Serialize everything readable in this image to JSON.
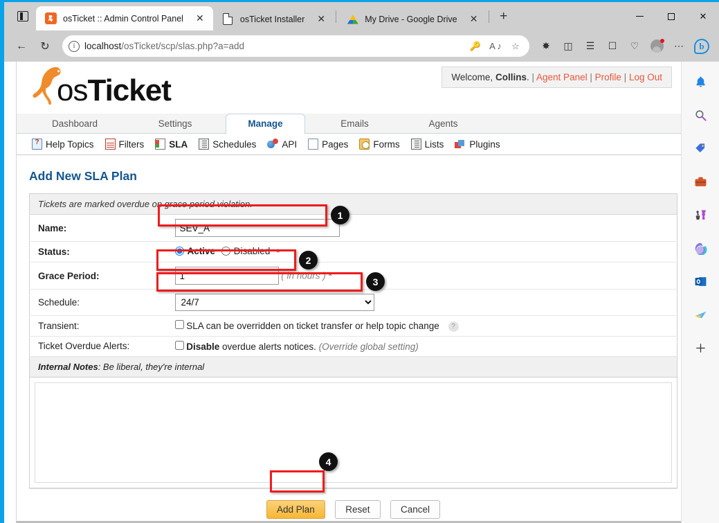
{
  "browser": {
    "tabs": [
      {
        "title": "osTicket :: Admin Control Panel",
        "icon": "osticket-favicon",
        "active": true
      },
      {
        "title": "osTicket Installer",
        "icon": "document-favicon",
        "active": false
      },
      {
        "title": "My Drive - Google Drive",
        "icon": "google-drive-favicon",
        "active": false
      }
    ],
    "new_tab_label": "+",
    "window_controls": {
      "minimize": "–",
      "maximize": "□",
      "close": "✕"
    },
    "address": {
      "host": "localhost",
      "path": "/osTicket/scp/slas.php?a=add",
      "full": "localhost/osTicket/scp/slas.php?a=add"
    },
    "back_label": "←",
    "refresh_label": "↻",
    "toolbar_icons": [
      "key-icon",
      "read-aloud-icon",
      "favorite-star-icon",
      "extensions-icon",
      "split-screen-icon",
      "collections-icon",
      "add-favorite-icon",
      "browser-essentials-icon",
      "profile-avatar",
      "settings-more-icon",
      "copilot-icon"
    ],
    "sidebar_icons": [
      "notifications-bell-icon",
      "search-icon",
      "shopping-tag-icon",
      "briefcase-icon",
      "games-icon",
      "microsoft-365-icon",
      "outlook-icon",
      "send-plane-icon",
      "add-sidebar-icon"
    ]
  },
  "osticket": {
    "logo_text_1": "os",
    "logo_text_2": "Ticket",
    "welcome": {
      "prefix": "Welcome,",
      "user": "Collins",
      "period": ".",
      "sep": "|",
      "agent_panel": "Agent Panel",
      "profile": "Profile",
      "logout": "Log Out"
    },
    "tabs": [
      {
        "label": "Dashboard",
        "active": false
      },
      {
        "label": "Settings",
        "active": false
      },
      {
        "label": "Manage",
        "active": true
      },
      {
        "label": "Emails",
        "active": false
      },
      {
        "label": "Agents",
        "active": false
      }
    ],
    "subnav": [
      {
        "label": "Help Topics",
        "icon": "help-topics-icon",
        "active": false
      },
      {
        "label": "Filters",
        "icon": "filters-icon",
        "active": false
      },
      {
        "label": "SLA",
        "icon": "sla-icon",
        "active": true
      },
      {
        "label": "Schedules",
        "icon": "schedules-icon",
        "active": false
      },
      {
        "label": "API",
        "icon": "api-icon",
        "active": false
      },
      {
        "label": "Pages",
        "icon": "pages-icon",
        "active": false
      },
      {
        "label": "Forms",
        "icon": "forms-icon",
        "active": false
      },
      {
        "label": "Lists",
        "icon": "lists-icon",
        "active": false
      },
      {
        "label": "Plugins",
        "icon": "plugins-icon",
        "active": false
      }
    ],
    "page_title": "Add New SLA Plan",
    "band_note": "Tickets are marked overdue on grace period violation.",
    "fields": {
      "name_label": "Name:",
      "name_value": "SEV_A",
      "status_label": "Status:",
      "status_active": "Active",
      "status_disabled": "Disabled",
      "status_required": "*",
      "grace_label": "Grace Period:",
      "grace_value": "1",
      "grace_hint": "( in hours )",
      "grace_required": "*",
      "schedule_label": "Schedule:",
      "schedule_value": "24/7",
      "schedule_options": [
        "24/7"
      ],
      "transient_label": "Transient:",
      "transient_text": "SLA can be overridden on ticket transfer or help topic change",
      "transient_help": "?",
      "transient_checked": false,
      "overdue_label": "Ticket Overdue Alerts:",
      "overdue_bold": "Disable",
      "overdue_text": " overdue alerts notices.",
      "overdue_note": "(Override global setting)",
      "overdue_checked": false
    },
    "internal_notes": {
      "heading": "Internal Notes",
      "subtitle": ": Be liberal, they're internal",
      "value": ""
    },
    "buttons": {
      "submit": "Add Plan",
      "reset": "Reset",
      "cancel": "Cancel"
    }
  },
  "annotations": [
    {
      "number": "1",
      "target": "name-field"
    },
    {
      "number": "2",
      "target": "grace-period-field"
    },
    {
      "number": "3",
      "target": "schedule-select"
    },
    {
      "number": "4",
      "target": "add-plan-button"
    }
  ],
  "colors": {
    "accent_orange": "#f26522",
    "link_red": "#e8563a",
    "title_blue": "#14568f",
    "annotation_red": "#ee1c1c",
    "window_border": "#0aa2e8"
  }
}
